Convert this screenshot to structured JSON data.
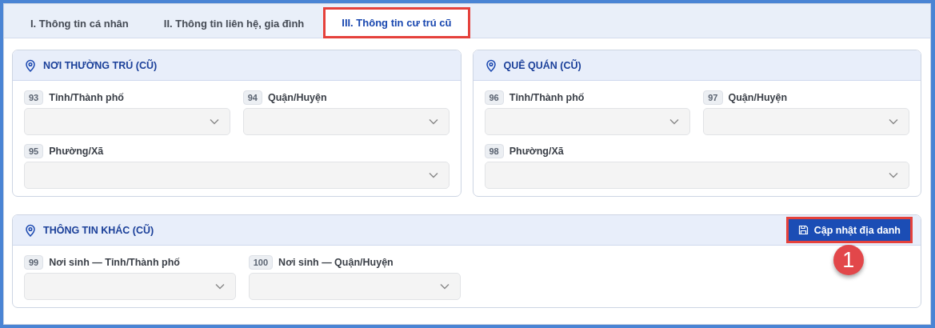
{
  "tabs": [
    {
      "label": "I. Thông tin cá nhân",
      "selected": false,
      "highlighted": false
    },
    {
      "label": "II. Thông tin liên hệ, gia đình",
      "selected": false,
      "highlighted": false
    },
    {
      "label": "III. Thông tin cư trú cũ",
      "selected": true,
      "highlighted": true
    }
  ],
  "rows": [
    {
      "sections": [
        {
          "title": "NƠI THƯỜNG TRÚ (CŨ)",
          "kind": "half",
          "fields": [
            {
              "number": "93",
              "label": "Tỉnh/Thành phố",
              "wide": false
            },
            {
              "number": "94",
              "label": "Quận/Huyện",
              "wide": false
            },
            {
              "number": "95",
              "label": "Phường/Xã",
              "wide": true
            }
          ]
        },
        {
          "title": "QUÊ QUÁN (CŨ)",
          "kind": "half",
          "fields": [
            {
              "number": "96",
              "label": "Tỉnh/Thành phố",
              "wide": false
            },
            {
              "number": "97",
              "label": "Quận/Huyện",
              "wide": false
            },
            {
              "number": "98",
              "label": "Phường/Xã",
              "wide": true
            }
          ]
        }
      ]
    },
    {
      "sections": [
        {
          "title": "THÔNG TIN KHÁC (CŨ)",
          "kind": "full",
          "action": {
            "label": "Cập nhật địa danh",
            "highlighted": true,
            "callout": "1"
          },
          "fields": [
            {
              "number": "99",
              "label": "Nơi sinh — Tỉnh/Thành phố",
              "wide": false
            },
            {
              "number": "100",
              "label": "Nơi sinh — Quận/Huyện",
              "wide": false
            }
          ]
        }
      ]
    }
  ]
}
